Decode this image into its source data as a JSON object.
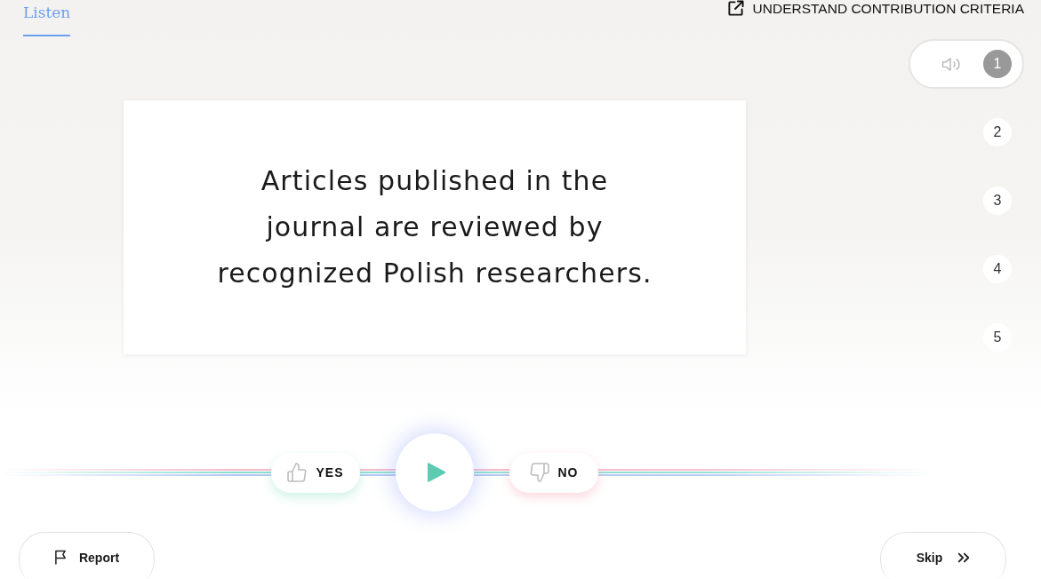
{
  "tabs": [
    {
      "label": "Listen",
      "selected": true
    }
  ],
  "criteria_link": {
    "label": "UNDERSTAND CONTRIBUTION CRITERIA"
  },
  "sentence": {
    "text": "Articles published in the journal are reviewed by recognized Polish researchers."
  },
  "clips": [
    {
      "number": "1",
      "selected": true
    },
    {
      "number": "2",
      "selected": false
    },
    {
      "number": "3",
      "selected": false
    },
    {
      "number": "4",
      "selected": false
    },
    {
      "number": "5",
      "selected": false
    }
  ],
  "controls": [
    {
      "kind": "vote_yes",
      "label": "YES"
    },
    {
      "kind": "play",
      "playing": false
    },
    {
      "kind": "vote_no",
      "label": "NO"
    }
  ],
  "footer_buttons": [
    {
      "kind": "report",
      "label": "Report"
    },
    {
      "kind": "skip",
      "label": "Skip"
    }
  ]
}
